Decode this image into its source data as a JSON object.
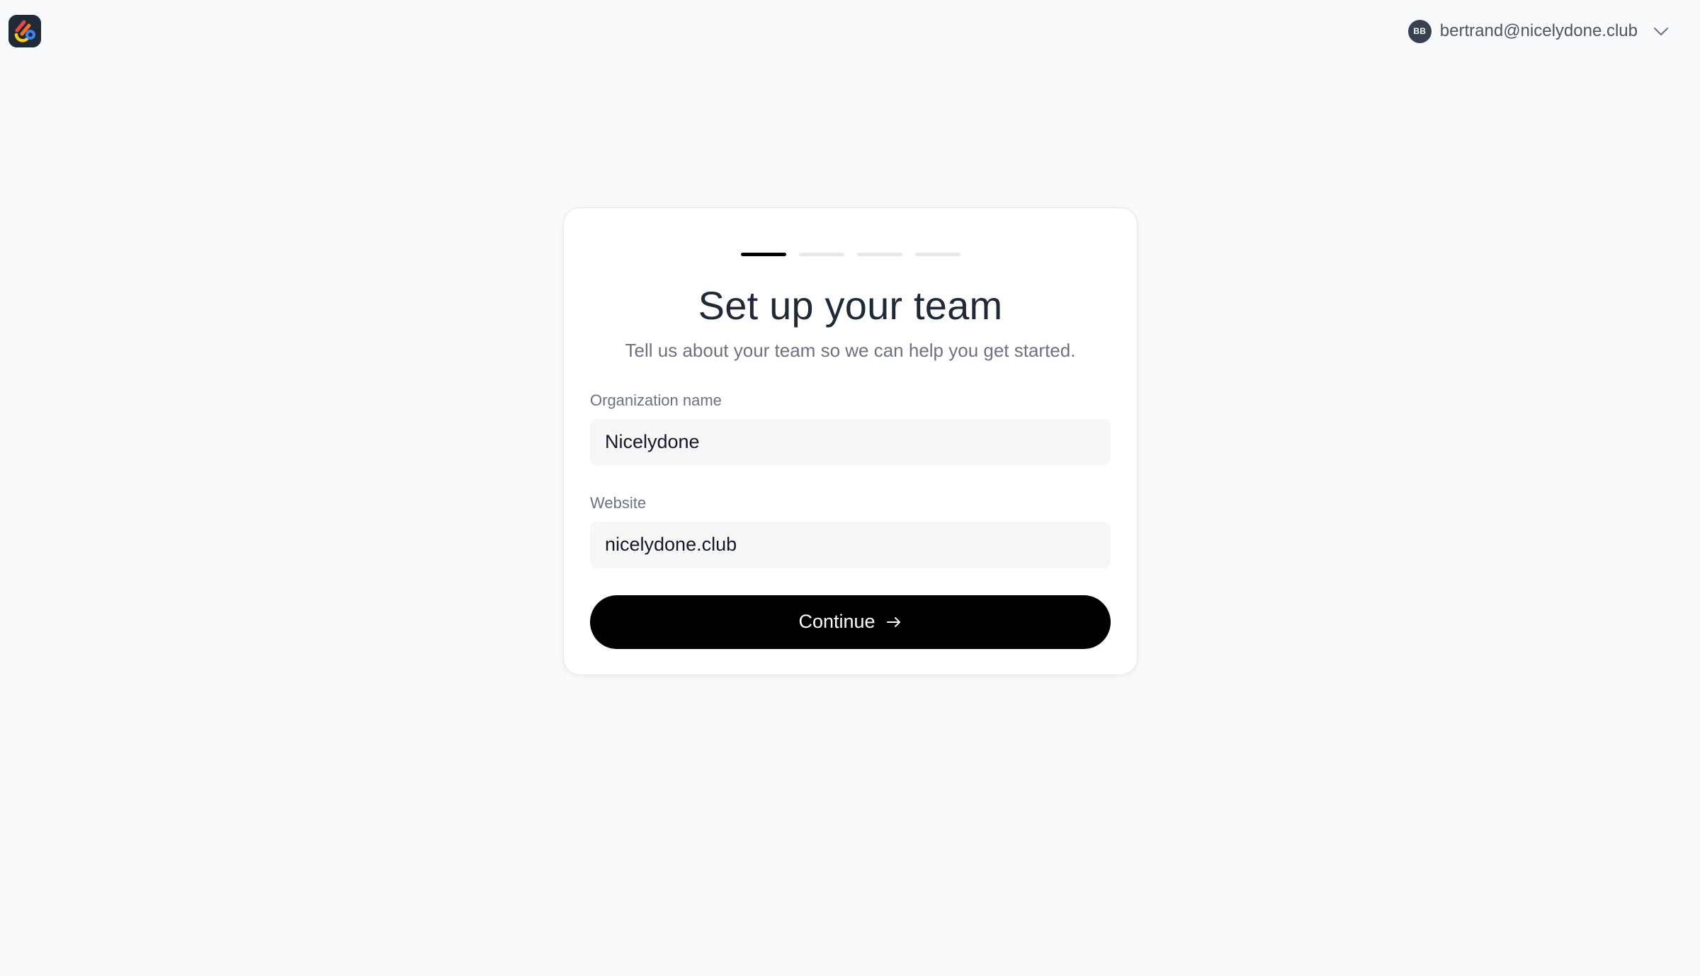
{
  "app": {
    "logo_icon": "app-logo-icon"
  },
  "user": {
    "initials": "BB",
    "email": "bertrand@nicelydone.club",
    "menu_icon": "chevron-down-icon"
  },
  "onboarding": {
    "progress": {
      "total_steps": 4,
      "current_step": 1
    },
    "title": "Set up your team",
    "subtitle": "Tell us about your team so we can help you get started.",
    "fields": {
      "organization": {
        "label": "Organization name",
        "value": "Nicelydone"
      },
      "website": {
        "label": "Website",
        "value": "nicelydone.club"
      }
    },
    "continue_label": "Continue",
    "continue_icon": "arrow-right-icon"
  },
  "colors": {
    "page_background": "#f9fafb",
    "primary_button": "#000000",
    "progress_active": "#000000",
    "progress_inactive": "#e5e7eb",
    "input_background": "#f7f7f7",
    "avatar_background": "#374151"
  }
}
